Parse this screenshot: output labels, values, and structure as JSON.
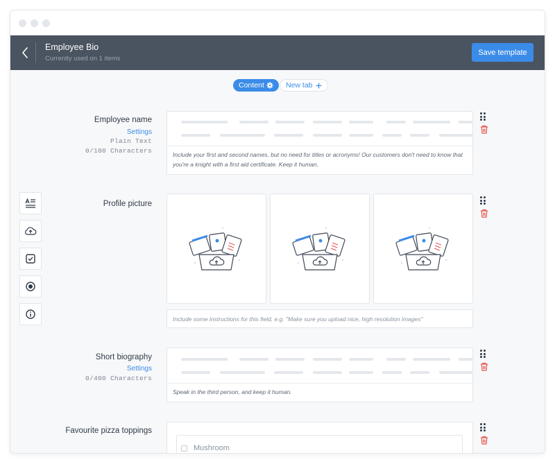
{
  "header": {
    "title": "Employee Bio",
    "subtitle": "Currently used on 1 items",
    "save_label": "Save template"
  },
  "tabs": {
    "content_label": "Content",
    "new_tab_label": "New tab"
  },
  "fields": {
    "employee_name": {
      "label": "Employee name",
      "settings_link": "Settings",
      "type": "Plain Text",
      "char_count": "0/100 Characters",
      "instructions": "Include your first and second names, but no need for titles or acronyms! Our customers don't need to know that you're a knight with a first aid certificate. Keep it human."
    },
    "profile_picture": {
      "label": "Profile picture",
      "instructions_placeholder": "Include some instructions for this field, e.g. \"Make sure you upload nice, high resolution images\""
    },
    "short_biography": {
      "label": "Short biography",
      "settings_link": "Settings",
      "char_count": "0/400 Characters",
      "instructions": "Speak in the third person, and keep it human."
    },
    "pizza_toppings": {
      "label": "Favourite pizza toppings",
      "options": [
        "Mushroom"
      ]
    }
  },
  "toolbox": [
    "text-field-tool",
    "upload-tool",
    "checkbox-tool",
    "radio-tool",
    "guideline-tool"
  ],
  "colors": {
    "accent": "#3b8ce8",
    "header_bg": "#4a5460",
    "delete": "#e5534b"
  }
}
